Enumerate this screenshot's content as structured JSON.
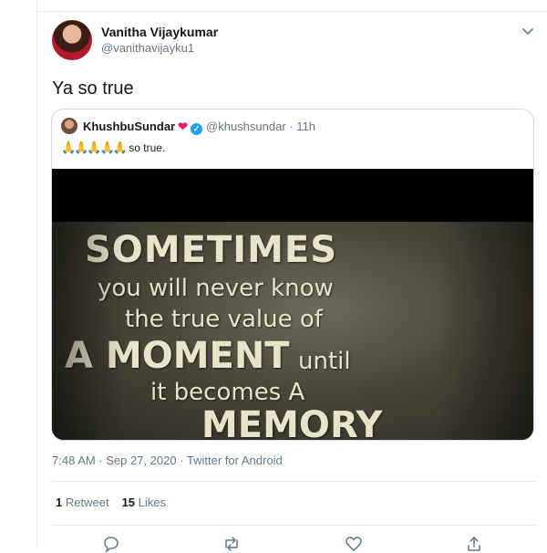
{
  "tweet": {
    "author_name": "Vanitha Vijaykumar",
    "author_handle": "@vanithavijayku1",
    "text": "Ya so true",
    "meta": "7:48 AM · Sep 27, 2020 · Twitter for Android",
    "retweets_count": "1",
    "retweets_label": "Retweet",
    "likes_count": "15",
    "likes_label": "Likes"
  },
  "quote": {
    "author_name": "KhushbuSundar",
    "heart": "❤",
    "verified": "✓",
    "handle_time": "@khushsundar · 11h",
    "emoji": "🙏🙏🙏🙏🙏",
    "text": "so true.",
    "image_lines": {
      "line1": "SOMETIMES",
      "line2": "you will never know",
      "line3": "the true value of",
      "line4": "A MOMENT",
      "line4b": "until",
      "line5": "it becomes A",
      "line6": "MEMORY"
    }
  },
  "icons": [
    "chevron-down-icon",
    "reply-icon",
    "retweet-icon",
    "like-icon",
    "share-icon"
  ],
  "colors": {
    "secondary_text": "#657786",
    "verified_blue": "#1da1f2",
    "heart_red": "#e0245e",
    "divider": "#e6ecf0"
  }
}
